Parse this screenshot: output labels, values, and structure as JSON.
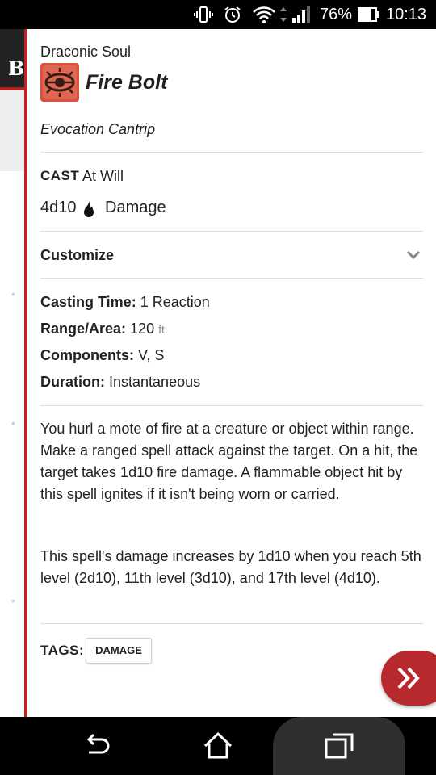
{
  "status_bar": {
    "battery_percent": "76%",
    "time": "10:13"
  },
  "background_app": {
    "header_letter": "B"
  },
  "spell": {
    "source": "Draconic Soul",
    "name": "Fire Bolt",
    "school": "Evocation Cantrip",
    "cast_label": "CAST",
    "cast_value": "At Will",
    "damage_dice": "4d10",
    "damage_label": "Damage",
    "customize_label": "Customize",
    "casting_time_label": "Casting Time:",
    "casting_time": "1 Reaction",
    "range_label": "Range/Area:",
    "range_value": "120",
    "range_unit": "ft.",
    "components_label": "Components:",
    "components": "V, S",
    "duration_label": "Duration:",
    "duration": "Instantaneous",
    "description_1": "You hurl a mote of fire at a creature or object within range. Make a ranged spell attack against the target. On a hit, the target takes 1d10 fire damage. A flammable object hit by this spell ignites if it isn't being worn or carried.",
    "description_2": "This spell's damage increases by 1d10 when you reach 5th level (2d10), 11th level (3d10), and 17th level (4d10).",
    "tags_label": "TAGS:",
    "tags": [
      "DAMAGE"
    ]
  },
  "colors": {
    "accent": "#b5252a",
    "fab": "#b8292e"
  },
  "icons": [
    "vibrate-icon",
    "alarm-icon",
    "wifi-icon",
    "signal-icon",
    "battery-icon",
    "spell-eye-icon",
    "fire-icon",
    "chevron-down-icon",
    "double-chevron-right-icon",
    "back-icon",
    "home-icon",
    "recents-icon"
  ]
}
